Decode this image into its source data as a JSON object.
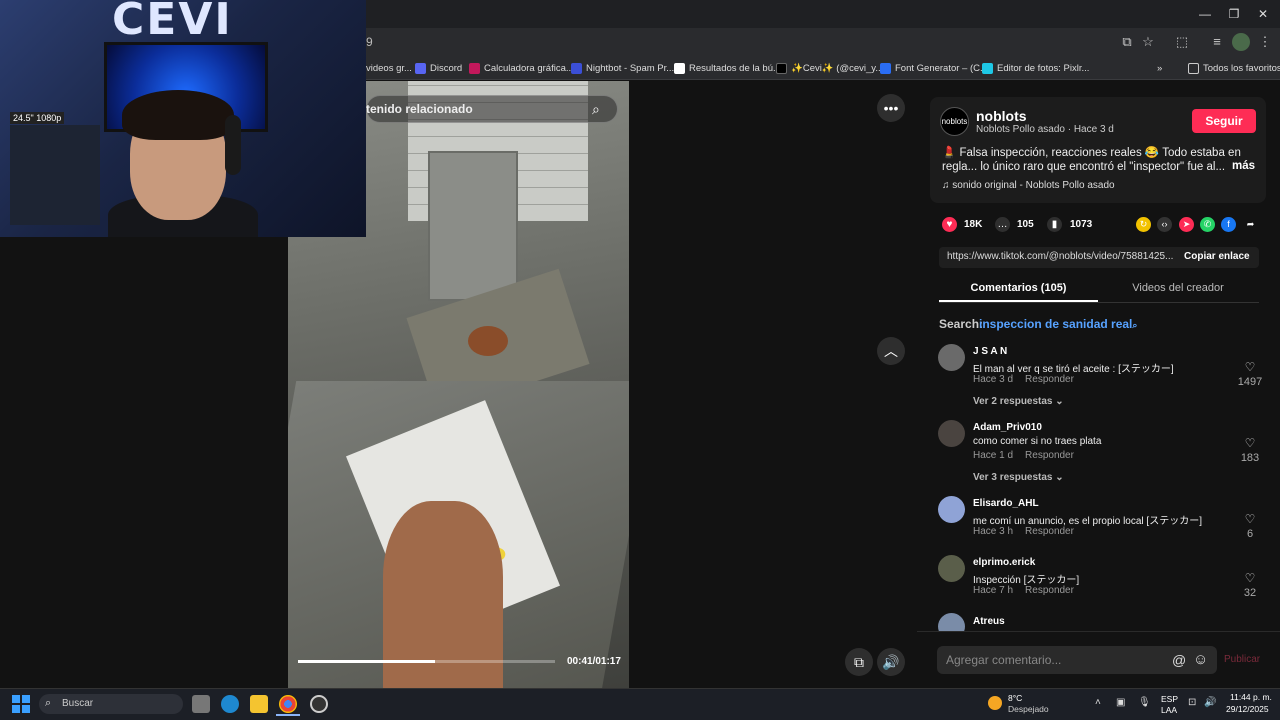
{
  "browser": {
    "url_fragment": "9",
    "bookmarks": [
      {
        "label": "videos gr...",
        "color": "#888888"
      },
      {
        "label": "Discord",
        "color": "#5865f2"
      },
      {
        "label": "Calculadora gráfica...",
        "color": "#c2185b"
      },
      {
        "label": "Nightbot - Spam Pr...",
        "color": "#3b4fd6"
      },
      {
        "label": "Resultados de la bú...",
        "color": "#ffffff"
      },
      {
        "label": "✨Cevi✨ (@cevi_y...",
        "color": "#000000"
      },
      {
        "label": "Font Generator – (C...",
        "color": "#2a6df4"
      },
      {
        "label": "Editor de fotos: Pixlr...",
        "color": "#1ec8e6"
      }
    ],
    "all_favorites": "Todos los favoritos"
  },
  "webcam": {
    "logo": "CEVI",
    "monitor_label": "24.5\" 1080p"
  },
  "video": {
    "search_placeholder": "tenido relacionado",
    "time": "00:41/01:17",
    "progress_fraction": 0.532
  },
  "creator": {
    "avatar_text": "noblots",
    "name": "noblots",
    "subtitle": "Noblots Pollo asado · Hace 3 d",
    "follow": "Seguir",
    "description": "💄 Falsa inspección, reacciones reales 😂 Todo estaba en regla... lo único raro que encontró el \"inspector\" fue al...",
    "more": "más",
    "sound": "♫  sonido original - Noblots Pollo asado"
  },
  "stats": {
    "likes": "18K",
    "comments": "105",
    "saves": "1073"
  },
  "share": {
    "link": "https://www.tiktok.com/@noblots/video/75881425...",
    "copy": "Copiar enlace"
  },
  "tabs": {
    "comments": "Comentarios (105)",
    "videos": "Videos del creador"
  },
  "search": {
    "label": "Search:",
    "term": "inspeccion de sanidad real"
  },
  "comments": [
    {
      "user": "J S A N",
      "text": "El man al ver q se tiró el aceite : [ステッカー]",
      "time": "Hace 3 d",
      "reply": "Responder",
      "likes": "1497",
      "replies": "Ver 2 respuestas ⌄",
      "avatar": "#6a6a6a"
    },
    {
      "user": "Adam_Priv010",
      "text": "como comer si no traes plata",
      "time": "Hace 1 d",
      "reply": "Responder",
      "likes": "183",
      "replies": "Ver 3 respuestas ⌄",
      "avatar": "#4a4440"
    },
    {
      "user": "Elisardo_AHL",
      "text": "me comí un anuncio, es el propio local [ステッカー]",
      "time": "Hace 3 h",
      "reply": "Responder",
      "likes": "6",
      "replies": "",
      "avatar": "#8fa3d6"
    },
    {
      "user": "elprimo.erick",
      "text": "Inspección [ステッカー]",
      "time": "Hace 7 h",
      "reply": "Responder",
      "likes": "32",
      "replies": "",
      "avatar": "#5a5e4a"
    },
    {
      "user": "Atreus",
      "text": "",
      "time": "",
      "reply": "",
      "likes": "",
      "replies": "",
      "avatar": "#7a8ca8"
    }
  ],
  "comment_box": {
    "placeholder": "Agregar comentario...",
    "publish": "Publicar"
  },
  "taskbar": {
    "search": "Buscar",
    "temp": "8°C",
    "weather": "Despejado",
    "lang1": "ESP",
    "lang2": "LAA",
    "time": "11:44 p. m.",
    "date": "29/12/2025"
  }
}
